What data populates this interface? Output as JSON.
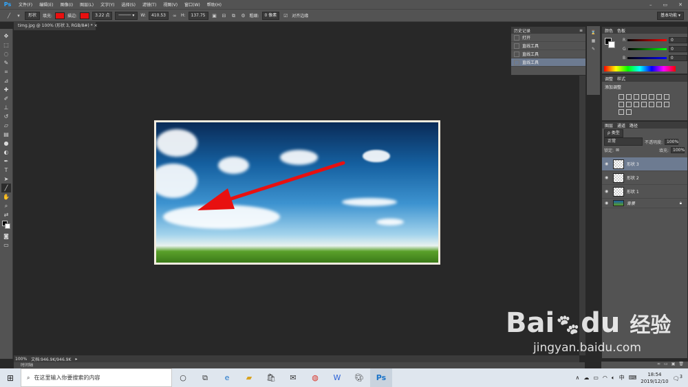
{
  "app": {
    "logo": "Ps"
  },
  "menu": [
    "文件(F)",
    "编辑(E)",
    "图像(I)",
    "图层(L)",
    "文字(Y)",
    "选择(S)",
    "滤镜(T)",
    "视图(V)",
    "窗口(W)",
    "帮助(H)"
  ],
  "window_controls": {
    "minimize": "–",
    "restore": "▭",
    "close": "✕"
  },
  "options": {
    "mode": "形状",
    "fill_label": "填充:",
    "stroke_label": "描边:",
    "stroke_width": "3.22 点",
    "w_label": "W:",
    "w_value": "410.53",
    "h_label": "H:",
    "h_value": "137.75",
    "weight_label": "粗细:",
    "weight_value": "0 像素",
    "align_label": "对齐边缘",
    "workspace": "基本功能",
    "fill_color": "#e81010",
    "stroke_color": "#e81010"
  },
  "document": {
    "tab_title": "timg.jpg @ 100% (形状 3, RGB/8#) *",
    "zoom": "100%",
    "doc_size": "文档:946.9K/946.9K",
    "timeline": "时间轴"
  },
  "history": {
    "tab": "历史记录",
    "items": [
      "打开",
      "直线工具",
      "直线工具",
      "直线工具"
    ]
  },
  "color": {
    "tabs": [
      "颜色",
      "色板"
    ],
    "channels": [
      {
        "label": "R",
        "value": "0",
        "gradient": "linear-gradient(to right,#000,#f00)"
      },
      {
        "label": "G",
        "value": "0",
        "gradient": "linear-gradient(to right,#000,#0f0)"
      },
      {
        "label": "B",
        "value": "0",
        "gradient": "linear-gradient(to right,#000,#00f)"
      }
    ]
  },
  "adjustments": {
    "tabs": [
      "调整",
      "样式"
    ],
    "title": "添加调整"
  },
  "layers": {
    "tabs": [
      "图层",
      "通道",
      "路径"
    ],
    "kind_filter": "ρ 类型",
    "blend_mode": "正常",
    "opacity_label": "不透明度:",
    "opacity_value": "100%",
    "lock_label": "锁定:",
    "fill_label": "填充:",
    "fill_value": "100%",
    "items": [
      {
        "name": "形状 3",
        "selected": true
      },
      {
        "name": "形状 2",
        "selected": false
      },
      {
        "name": "形状 1",
        "selected": false
      },
      {
        "name": "背景",
        "selected": false
      }
    ]
  },
  "taskbar": {
    "search_placeholder": "在这里输入你要搜索的内容",
    "time": "18:54",
    "date": "2019/12/10",
    "ime": "中",
    "notification_count": "3"
  },
  "watermark": {
    "brand": "Bai",
    "brand2": "du",
    "cn": "经验",
    "url": "jingyan.baidu.com"
  }
}
